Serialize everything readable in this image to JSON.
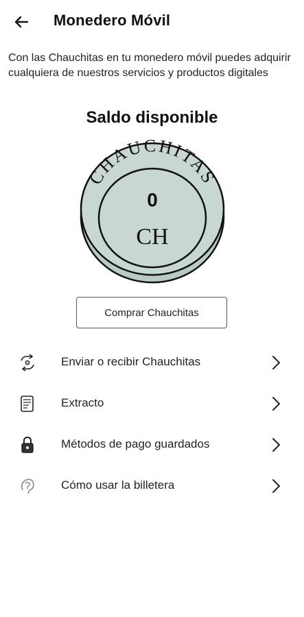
{
  "header": {
    "title": "Monedero Móvil",
    "back_icon": "arrow-left-icon"
  },
  "intro": {
    "text": "Con las Chauchitas en tu monedero móvil puedes adquirir cualquiera de nuestros servicios y productos digitales"
  },
  "wallet": {
    "title": "Saldo disponible",
    "balance": "0",
    "coin_text": "CHAUCHITAS",
    "coin_monogram": "CH",
    "coin_color": "#c9d7d3"
  },
  "buy_button": {
    "label": "Comprar Chauchitas"
  },
  "menu": [
    {
      "label": "Enviar o recibir Chauchitas",
      "icon": "transfer-icon"
    },
    {
      "label": "Extracto",
      "icon": "document-icon"
    },
    {
      "label": "Métodos de pago guardados",
      "icon": "lock-icon"
    },
    {
      "label": "Cómo usar la billetera",
      "icon": "help-icon"
    }
  ]
}
